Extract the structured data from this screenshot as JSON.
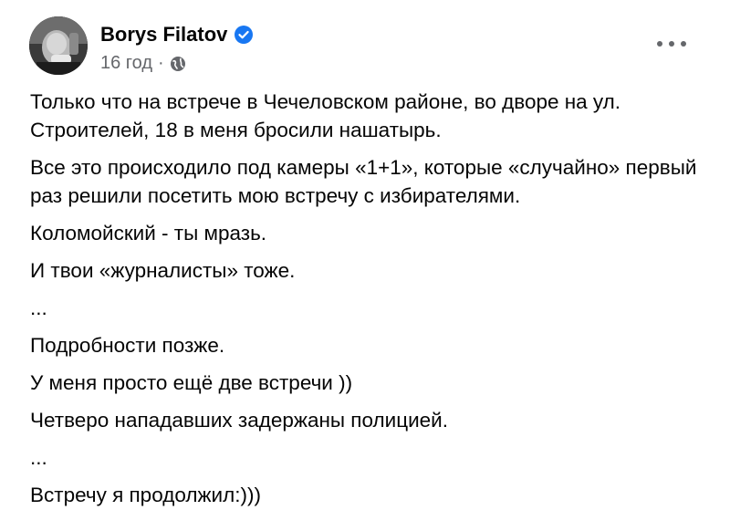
{
  "post": {
    "author": "Borys Filatov",
    "timestamp": "16 год",
    "separator": "·",
    "icons": {
      "verified": "verified-badge-icon",
      "audience": "globe-icon",
      "more": "more-options-icon"
    },
    "colors": {
      "verified_blue": "#1877f2",
      "meta_gray": "#65676b",
      "text": "#050505"
    },
    "paragraphs": [
      "Только что на встрече в Чечеловском районе, во дворе на ул. Строителей, 18 в меня бросили нашатырь.",
      "Все это происходило под камеры «1+1», которые «случайно» первый раз решили посетить мою встречу с избирателями.",
      "Коломойский - ты мразь.",
      "И твои «журналисты» тоже.",
      "...",
      "Подробности позже.",
      "У меня просто ещё две встречи ))",
      "Четверо нападавших задержаны полицией.",
      "...",
      "Встречу я продолжил:)))"
    ]
  }
}
